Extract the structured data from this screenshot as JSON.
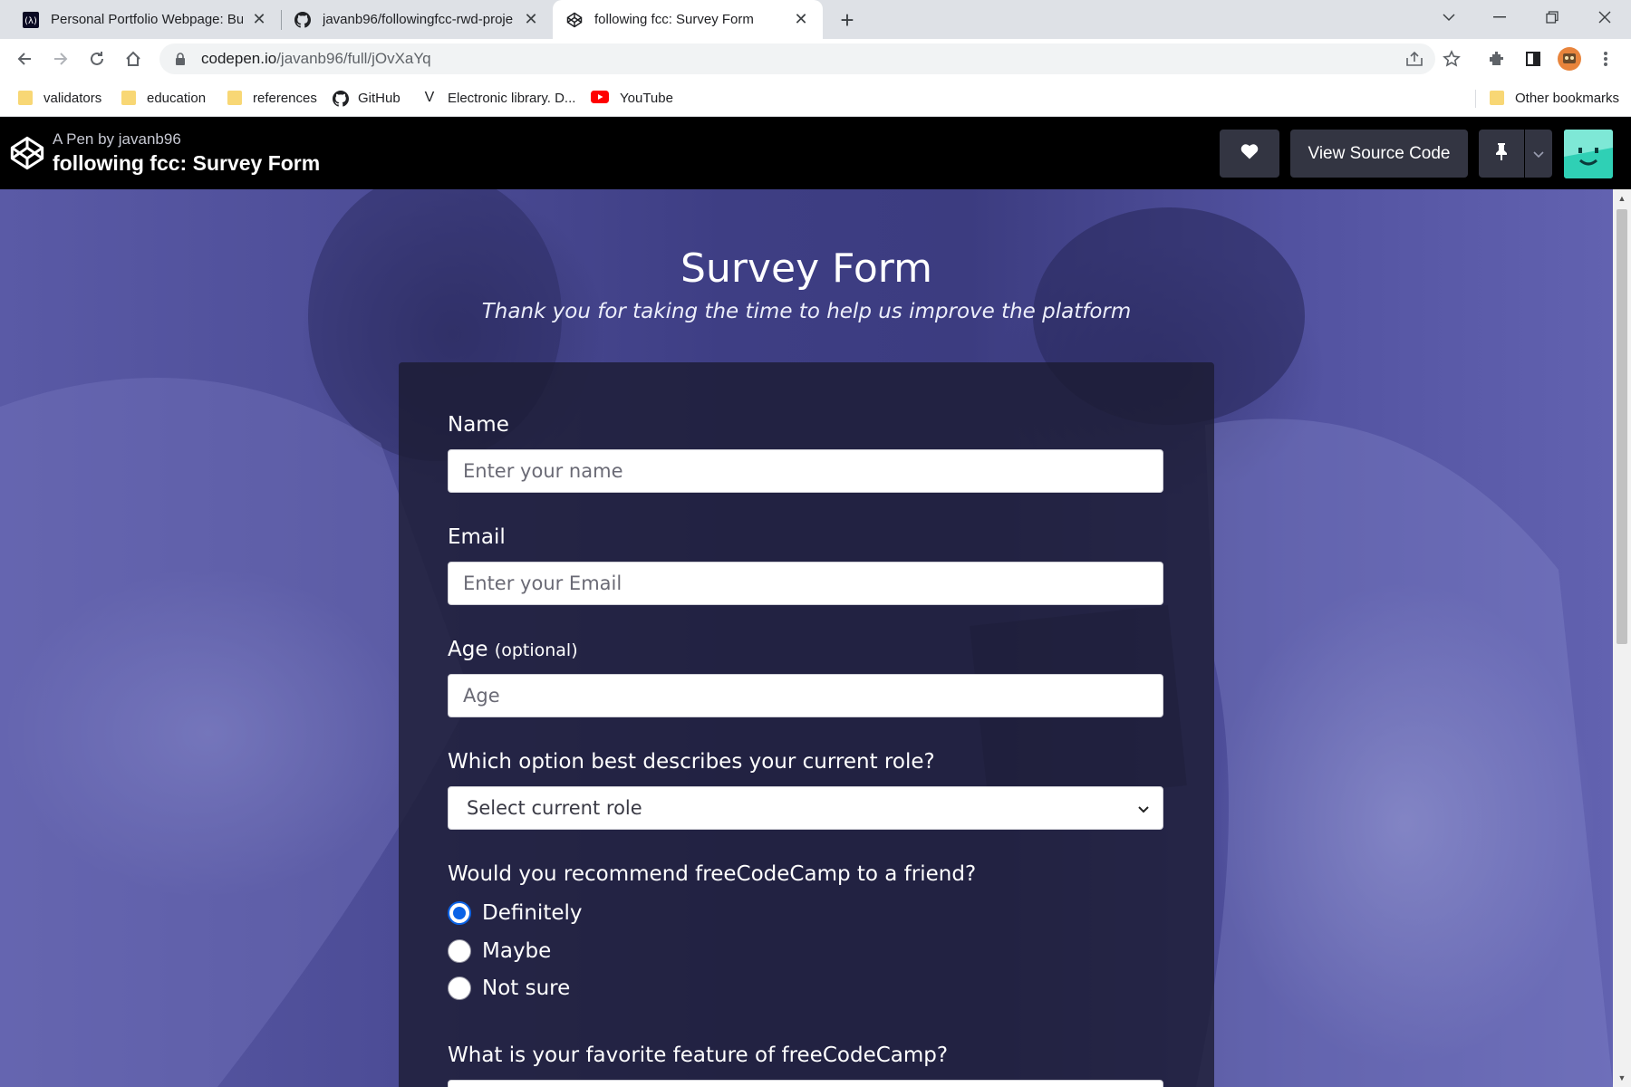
{
  "browser": {
    "tabs": [
      {
        "title": "Personal Portfolio Webpage: Buil",
        "active": false
      },
      {
        "title": "javanb96/followingfcc-rwd-proje",
        "active": false
      },
      {
        "title": "following fcc: Survey Form",
        "active": true
      }
    ],
    "url_host": "codepen.io",
    "url_path": "/javanb96/full/jOvXaYq",
    "bookmarks": [
      "validators",
      "education",
      "references",
      "GitHub",
      "Electronic library. D...",
      "YouTube"
    ],
    "other_bookmarks": "Other bookmarks"
  },
  "codepen": {
    "byline": "A Pen by javanb96",
    "pen_title": "following fcc: Survey Form",
    "view_source_label": "View Source Code"
  },
  "survey": {
    "title": "Survey Form",
    "description": "Thank you for taking the time to help us improve the platform",
    "name_label": "Name",
    "name_placeholder": "Enter your name",
    "email_label": "Email",
    "email_placeholder": "Enter your Email",
    "age_label": "Age",
    "age_clue": "(optional)",
    "age_placeholder": "Age",
    "role_label": "Which option best describes your current role?",
    "role_selected": "Select current role",
    "recommend_label": "Would you recommend freeCodeCamp to a friend?",
    "recommend_options": [
      "Definitely",
      "Maybe",
      "Not sure"
    ],
    "favorite_label": "What is your favorite feature of freeCodeCamp?"
  },
  "colors": {
    "header_bg": "#000000",
    "radio_accent": "#0b63e6",
    "card_bg": "#1b1b32"
  }
}
